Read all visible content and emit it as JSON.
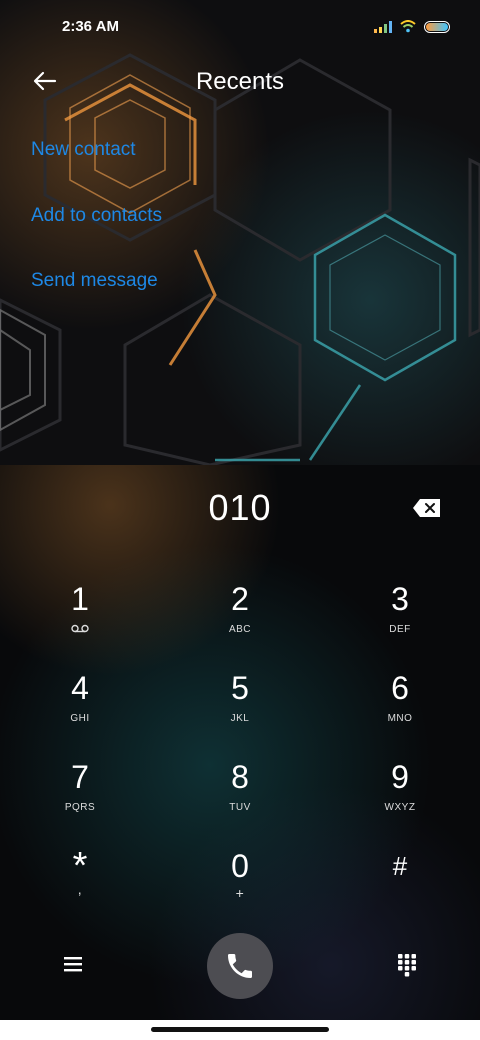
{
  "status": {
    "time": "2:36 AM"
  },
  "header": {
    "title": "Recents"
  },
  "menu": [
    "New contact",
    "Add to contacts",
    "Send message"
  ],
  "dialer": {
    "number": "010",
    "keys": [
      {
        "digit": "1",
        "letters": ""
      },
      {
        "digit": "2",
        "letters": "ABC"
      },
      {
        "digit": "3",
        "letters": "DEF"
      },
      {
        "digit": "4",
        "letters": "GHI"
      },
      {
        "digit": "5",
        "letters": "JKL"
      },
      {
        "digit": "6",
        "letters": "MNO"
      },
      {
        "digit": "7",
        "letters": "PQRS"
      },
      {
        "digit": "8",
        "letters": "TUV"
      },
      {
        "digit": "9",
        "letters": "WXYZ"
      },
      {
        "digit": "*",
        "letters": ","
      },
      {
        "digit": "0",
        "letters": "+"
      },
      {
        "digit": "#",
        "letters": ""
      }
    ]
  },
  "colors": {
    "link": "#1e88e5",
    "call_button": "#4d4d52"
  },
  "icons": [
    "back-arrow-icon",
    "backspace-icon",
    "voicemail-icon",
    "menu-icon",
    "phone-icon",
    "keypad-icon",
    "signal-icon",
    "wifi-icon",
    "battery-icon"
  ]
}
